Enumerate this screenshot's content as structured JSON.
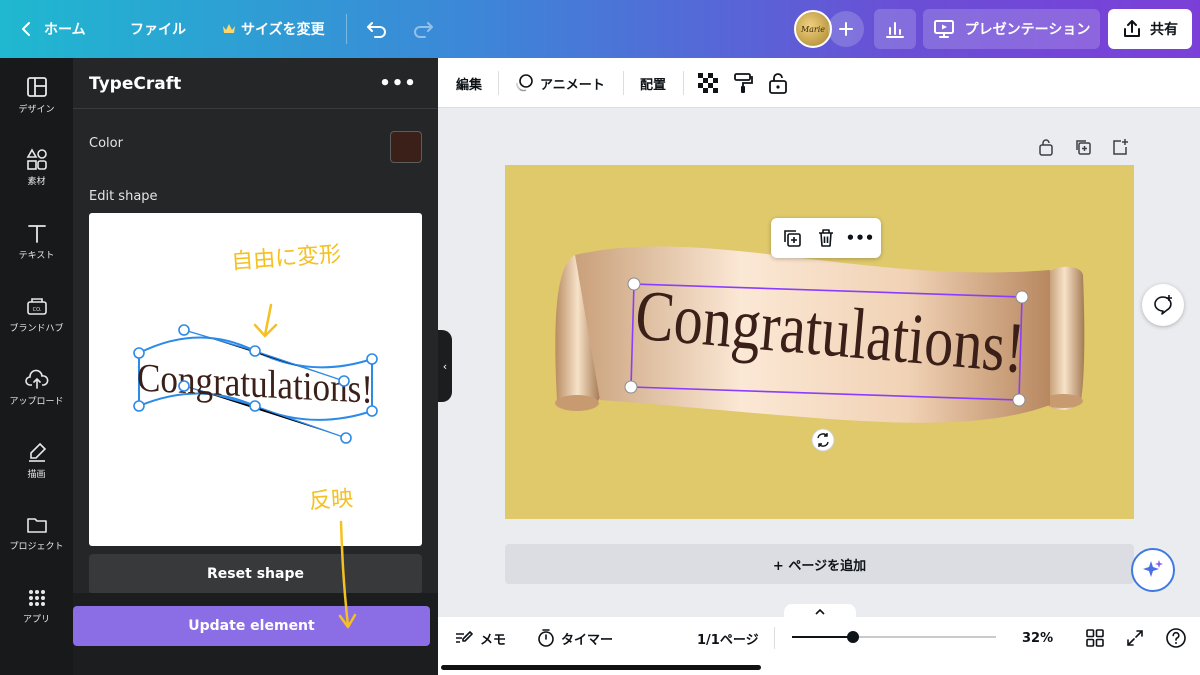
{
  "topbar": {
    "home_label": "ホーム",
    "file_label": "ファイル",
    "resize_label": "サイズを変更",
    "avatar_text": "Marie",
    "present_label": "プレゼンテーション",
    "share_label": "共有"
  },
  "rail": {
    "items": [
      {
        "label": "デザイン",
        "icon": "layout-icon"
      },
      {
        "label": "素材",
        "icon": "shapes-icon"
      },
      {
        "label": "テキスト",
        "icon": "text-icon"
      },
      {
        "label": "ブランドハブ",
        "icon": "brand-icon"
      },
      {
        "label": "アップロード",
        "icon": "upload-icon"
      },
      {
        "label": "描画",
        "icon": "draw-icon"
      },
      {
        "label": "プロジェクト",
        "icon": "folder-icon"
      },
      {
        "label": "アプリ",
        "icon": "apps-icon"
      }
    ]
  },
  "panel": {
    "title": "TypeCraft",
    "color_label": "Color",
    "color_value": "#3a2018",
    "edit_shape_label": "Edit shape",
    "preview_text": "Congratulations!",
    "reset_label": "Reset shape",
    "update_label": "Update element"
  },
  "annotations": {
    "free_transform": "自由に変形",
    "apply": "反映",
    "color": "#f5c021"
  },
  "toolbar": {
    "edit_label": "編集",
    "animate_label": "アニメート",
    "position_label": "配置"
  },
  "canvas": {
    "background_color": "#dfc96b",
    "text": "Congratulations!",
    "add_page_label": "+ ページを追加"
  },
  "bottombar": {
    "notes_label": "メモ",
    "timer_label": "タイマー",
    "page_label": "1/1ページ",
    "zoom_label": "32%",
    "zoom_fraction": 0.3
  },
  "colors": {
    "accent_purple": "#8b6de6",
    "selection": "#8b3dff"
  }
}
